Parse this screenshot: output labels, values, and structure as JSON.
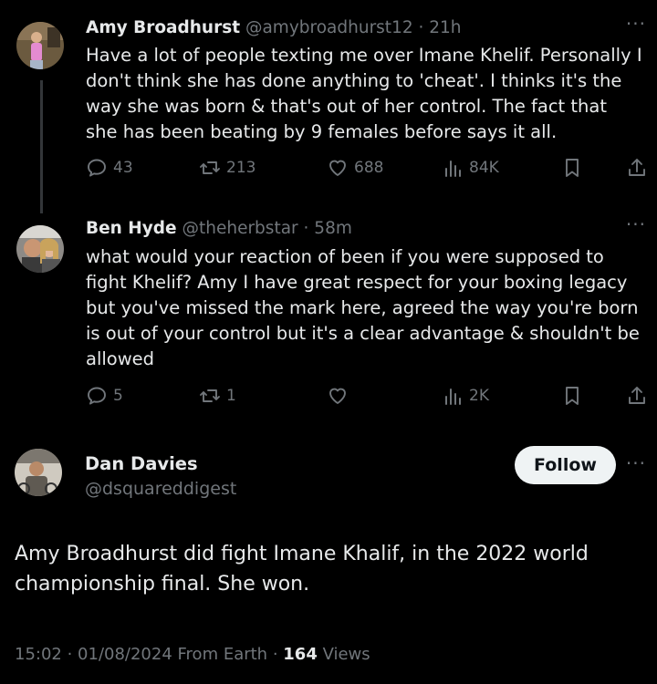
{
  "tweets": [
    {
      "name": "Amy Broadhurst",
      "handle": "@amybroadhurst12",
      "time": "21h",
      "text": "Have a lot of people texting me over Imane Khelif. Personally I don't think she has done anything to 'cheat'. I thinks it's the way she was born & that's out of her control. The fact that she has been beating by 9 females before says it all.",
      "replies": "43",
      "reposts": "213",
      "likes": "688",
      "views": "84K"
    },
    {
      "name": "Ben Hyde",
      "handle": "@theherbstar",
      "time": "58m",
      "text": "what would your reaction of been if you were supposed to fight Khelif? Amy I have great respect for your boxing legacy but you've missed the mark here, agreed the way you're born is out of your control but it's a clear advantage & shouldn't be allowed",
      "replies": "5",
      "reposts": "1",
      "likes": "",
      "views": "2K"
    }
  ],
  "main_post": {
    "name": "Dan Davies",
    "handle": "@dsquareddigest",
    "follow_label": "Follow",
    "text": "Amy Broadhurst  did fight Imane Khalif, in the 2022 world championship final. She won.",
    "timestamp": "15:02 · 01/08/2024 From Earth · ",
    "views_count": "164",
    "views_label": " Views"
  },
  "icons": {
    "reply": "reply-icon",
    "repost": "repost-icon",
    "like": "heart-icon",
    "views": "views-icon",
    "bookmark": "bookmark-icon",
    "share": "share-icon",
    "more": "more-icon"
  },
  "colors": {
    "background": "#000000",
    "text": "#e7e9ea",
    "muted": "#71767b",
    "follow_bg": "#eff3f4"
  }
}
